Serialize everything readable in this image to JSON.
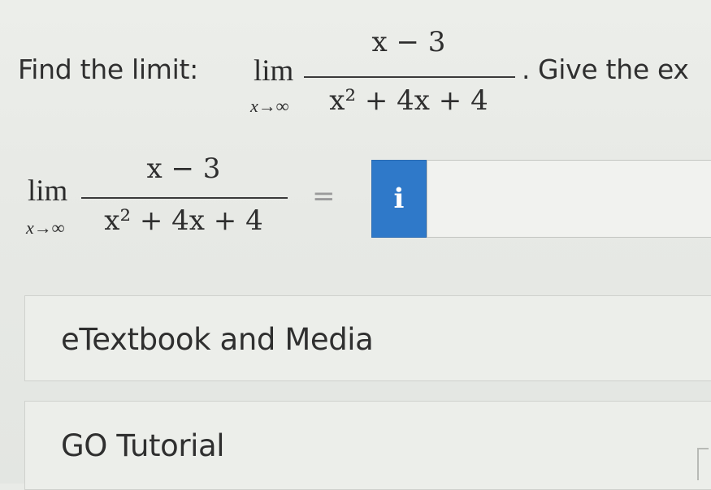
{
  "question": {
    "prefix": "Find the limit:",
    "suffix": "Give the ex",
    "period": ".",
    "lim": "lim",
    "lim_sub": "x→∞",
    "numerator": "x − 3",
    "denominator": "x² + 4x + 4"
  },
  "answer_row": {
    "lim": "lim",
    "lim_sub": "x→∞",
    "numerator": "x − 3",
    "denominator": "x² + 4x + 4",
    "equals": "=",
    "info_icon": "info-icon",
    "info_glyph": "i",
    "input_value": ""
  },
  "panels": {
    "media_label": "eTextbook and Media",
    "tutorial_label": "GO Tutorial"
  },
  "colors": {
    "accent": "#2f79c9",
    "background": "#e9ebe7",
    "text": "#2e2e2e"
  }
}
